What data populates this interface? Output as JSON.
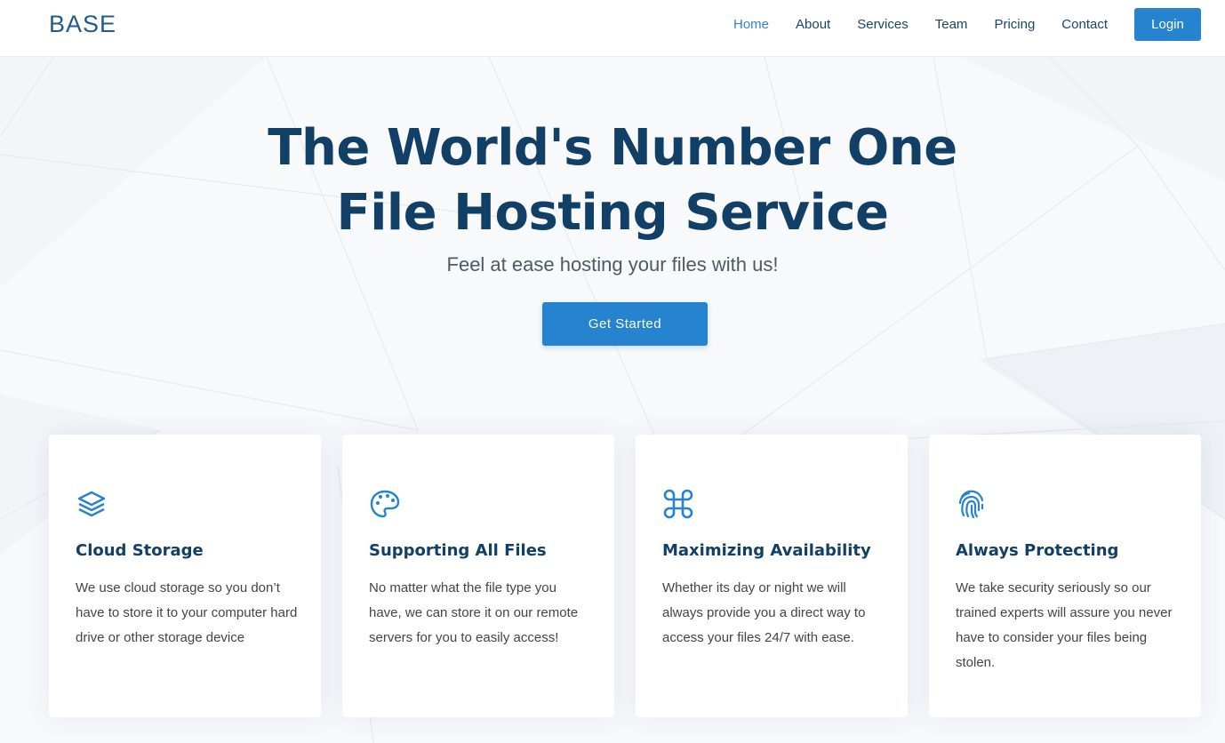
{
  "header": {
    "logo": "BASE",
    "nav": [
      {
        "label": "Home",
        "active": true
      },
      {
        "label": "About",
        "active": false
      },
      {
        "label": "Services",
        "active": false
      },
      {
        "label": "Team",
        "active": false
      },
      {
        "label": "Pricing",
        "active": false
      },
      {
        "label": "Contact",
        "active": false
      }
    ],
    "login_label": "Login"
  },
  "hero": {
    "title_line1": "The World's Number One",
    "title_line2": "File Hosting Service",
    "subtitle": "Feel at ease hosting your files with us!",
    "cta_label": "Get Started"
  },
  "features": [
    {
      "icon": "layers-icon",
      "title": "Cloud Storage",
      "desc": "We use cloud storage so you don’t have to store it to your computer hard drive or other storage device"
    },
    {
      "icon": "palette-icon",
      "title": "Supporting All Files",
      "desc": "No matter what the file type you have, we can store it on our remote servers for you to easily access!"
    },
    {
      "icon": "command-icon",
      "title": "Maximizing Availability",
      "desc": "Whether its day or night we will always provide you a direct way to access your files 24/7 with ease."
    },
    {
      "icon": "fingerprint-icon",
      "title": "Always Protecting",
      "desc": "We take security seriously so our trained experts will assure you never have to consider your files being stolen."
    }
  ],
  "colors": {
    "accent": "#2583cf",
    "heading": "#123f66",
    "nav_text": "#18456d",
    "body_text": "#444444"
  }
}
